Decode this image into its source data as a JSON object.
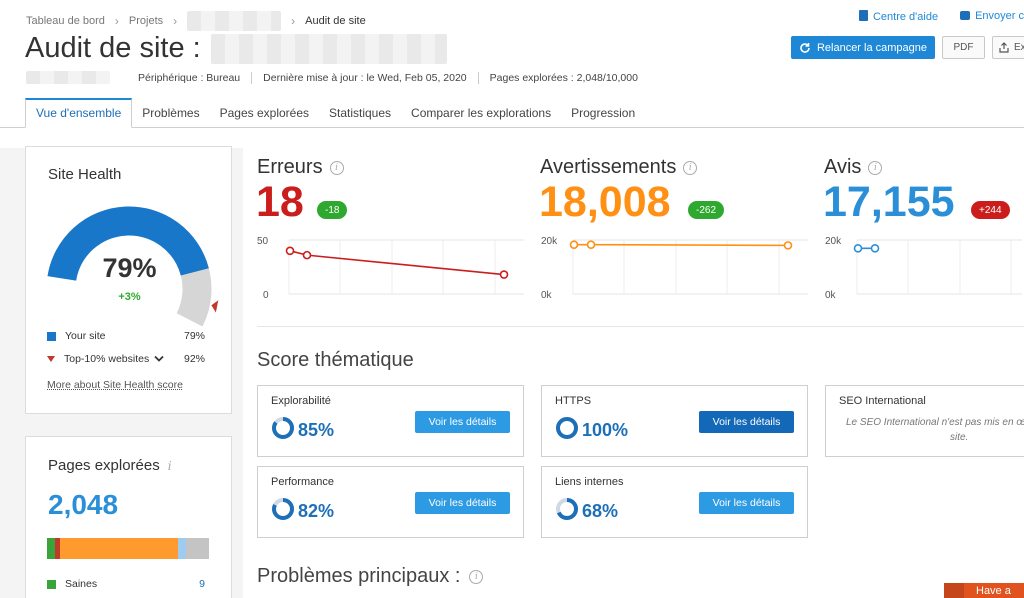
{
  "breadcrumb": {
    "items": [
      "Tableau de bord",
      "Projets",
      "",
      "Audit de site"
    ]
  },
  "help": {
    "center": "Centre d'aide",
    "send": "Envoyer c"
  },
  "page": {
    "title": "Audit de site :",
    "rerun_label": "Relancer la campagne",
    "pdf_label": "PDF",
    "export_label": "Ex"
  },
  "meta": {
    "device": "Périphérique : Bureau",
    "updated": "Dernière mise à jour : le Wed, Feb 05, 2020",
    "pages": "Pages explorées : 2,048/10,000"
  },
  "tabs": [
    "Vue d'ensemble",
    "Problèmes",
    "Pages explorées",
    "Statistiques",
    "Comparer les explorations",
    "Progression"
  ],
  "site_health": {
    "title": "Site Health",
    "score": "79%",
    "score_fraction": 0.79,
    "top10_fraction": 0.92,
    "delta": "+3%",
    "your_site_label": "Your site",
    "your_site_value": "79%",
    "top10_label": "Top-10% websites",
    "top10_value": "92%",
    "more_link": "More about Site Health score",
    "colors": {
      "primary": "#1877c9",
      "track": "#d6d6d6",
      "marker": "#c0392b"
    }
  },
  "pages_crawled": {
    "title": "Pages explorées",
    "count": "2,048",
    "bar_segments": [
      {
        "name": "healthy",
        "fraction": 0.05,
        "color": "#3aa33a"
      },
      {
        "name": "broken",
        "fraction": 0.03,
        "color": "#c0392b"
      },
      {
        "name": "have-issues",
        "fraction": 0.73,
        "color": "#ff9a2e"
      },
      {
        "name": "redirected",
        "fraction": 0.05,
        "color": "#9fcbf0"
      },
      {
        "name": "blocked",
        "fraction": 0.14,
        "color": "#c4c4c4"
      }
    ],
    "legend": [
      {
        "label": "Saines",
        "value": "9",
        "color": "#3aa33a"
      }
    ]
  },
  "metrics": [
    {
      "title": "Erreurs",
      "value": "18",
      "color": "#cc1d1d",
      "badge": "-18",
      "badge_color": "#2fa82f",
      "y_top": "50",
      "y_bottom": "0",
      "trend": [
        40,
        36,
        18
      ],
      "trend_max": 50
    },
    {
      "title": "Avertissements",
      "value": "18,008",
      "color": "#ff9014",
      "badge": "-262",
      "badge_color": "#2fa82f",
      "y_top": "20k",
      "y_bottom": "0k",
      "trend": [
        18270,
        18270,
        18008
      ],
      "trend_max": 20000
    },
    {
      "title": "Avis",
      "value": "17,155",
      "color": "#2b8fd8",
      "badge": "+244",
      "badge_color": "#cc1d1d",
      "y_top": "20k",
      "y_bottom": "0k",
      "trend": [
        16911,
        16911
      ],
      "trend_max": 20000
    }
  ],
  "thematic": {
    "title": "Score thématique",
    "cards": [
      {
        "title": "Explorabilité",
        "pct": "85%",
        "fraction": 0.85,
        "button": "Voir les détails",
        "dark": false
      },
      {
        "title": "HTTPS",
        "pct": "100%",
        "fraction": 1.0,
        "button": "Voir les détails",
        "dark": true
      },
      {
        "title": "Performance",
        "pct": "82%",
        "fraction": 0.82,
        "button": "Voir les détails",
        "dark": false
      },
      {
        "title": "Liens internes",
        "pct": "68%",
        "fraction": 0.68,
        "button": "Voir les détails",
        "dark": false
      }
    ],
    "seo_intl": {
      "title": "SEO International",
      "text": "Le SEO International n'est pas mis en œ",
      "text2": "site."
    }
  },
  "top_issues": {
    "title": "Problèmes principaux :"
  },
  "chat": {
    "label": "Have a"
  }
}
